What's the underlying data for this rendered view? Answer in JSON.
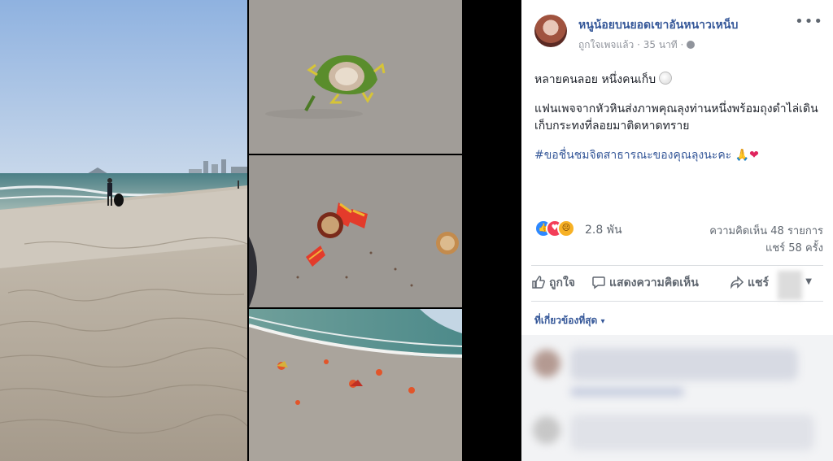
{
  "post": {
    "page_name": "หนูน้อยบนยอดเขาอันหนาวเหน็บ",
    "meta_liked": "ถูกใจเพจแล้ว",
    "meta_dot": "·",
    "meta_time": "35 นาที",
    "meta_dot2": "·",
    "more_label": "•••",
    "line1": "หลายคนลอย หนึ่งคนเก็บ",
    "line2": "แฟนเพจจากหัวหินส่งภาพคุณลุงท่านหนึ่งพร้อมถุงดำไล่เดินเก็บกระทงที่ลอยมาติดหาดทราย",
    "hashtag": "#ขอชื่นชมจิตสาธารณะของคุณลุงนะคะ",
    "hashtag_emoji": "🙏❤"
  },
  "reactions": {
    "icons": [
      "like-icon",
      "love-icon",
      "sad-icon"
    ],
    "count": "2.8 พัน",
    "comments": "ความคิดเห็น 48 รายการ",
    "shares": "แชร์ 58 ครั้ง"
  },
  "actions": {
    "like": "ถูกใจ",
    "comment": "แสดงความคิดเห็น",
    "share": "แชร์"
  },
  "comments": {
    "sort_label": "ที่เกี่ยวข้องที่สุด",
    "sort_caret": "▾"
  },
  "colors": {
    "link": "#365899",
    "secondary": "#90949c",
    "like": "#2d88ff",
    "love": "#f33e58"
  }
}
